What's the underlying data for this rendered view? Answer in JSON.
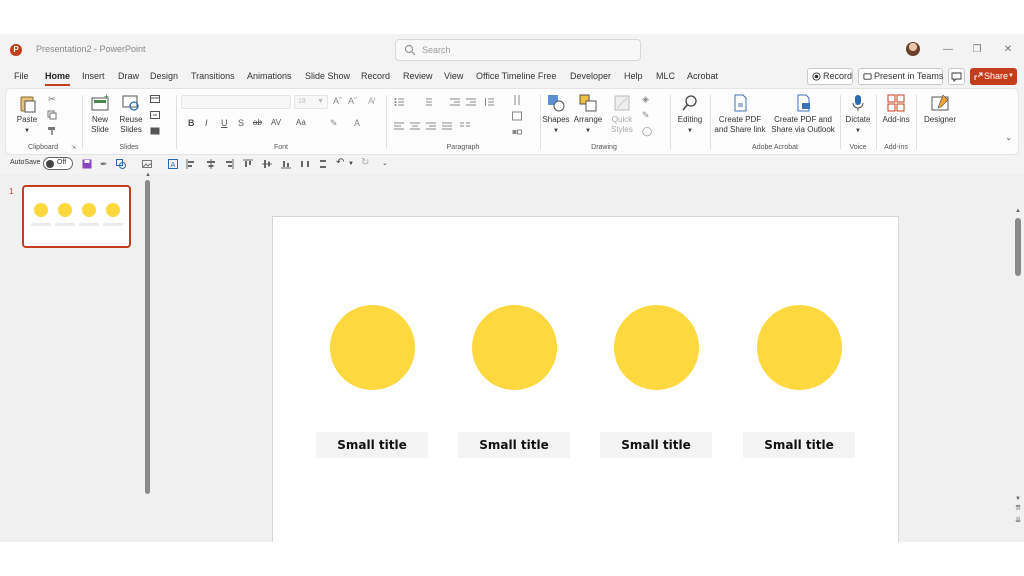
{
  "window": {
    "title": "Presentation2  -  PowerPoint",
    "logo": "P"
  },
  "search": {
    "placeholder": "Search"
  },
  "menu": {
    "tabs": [
      "File",
      "Home",
      "Insert",
      "Draw",
      "Design",
      "Transitions",
      "Animations",
      "Slide Show",
      "Record",
      "Review",
      "View",
      "Office Timeline Free",
      "Developer",
      "Help",
      "MLC",
      "Acrobat"
    ],
    "active": "Home",
    "record_label": "Record",
    "present_label": "Present in Teams",
    "share_label": "Share"
  },
  "ribbon": {
    "clipboard": {
      "paste": "Paste",
      "label": "Clipboard"
    },
    "slides": {
      "new_slide": "New Slide",
      "reuse_slides": "Reuse Slides",
      "label": "Slides"
    },
    "font": {
      "size": "18",
      "label": "Font"
    },
    "paragraph": {
      "label": "Paragraph"
    },
    "drawing": {
      "shapes": "Shapes",
      "arrange": "Arrange",
      "quick_styles": "Quick Styles",
      "label": "Drawing"
    },
    "editing": {
      "editing": "Editing"
    },
    "acrobat": {
      "create_pdf": "Create PDF and Share link",
      "create_pdf_outlook": "Create PDF and Share via Outlook",
      "label": "Adobe Acrobat"
    },
    "voice": {
      "dictate": "Dictate",
      "label": "Voice"
    },
    "addins": {
      "addins": "Add-ins",
      "label": "Add-ins"
    },
    "designer": {
      "designer": "Designer"
    }
  },
  "qat": {
    "autosave_label": "AutoSave",
    "autosave_state": "Off"
  },
  "thumbnails": [
    {
      "number": "1"
    }
  ],
  "slide": {
    "captions": [
      "Small title",
      "Small title",
      "Small title",
      "Small title"
    ],
    "circle_color": "#fdd93f"
  },
  "colors": {
    "accent": "#c43e1c",
    "circle": "#fdd93f",
    "caption_bg": "#f3f3f3"
  }
}
